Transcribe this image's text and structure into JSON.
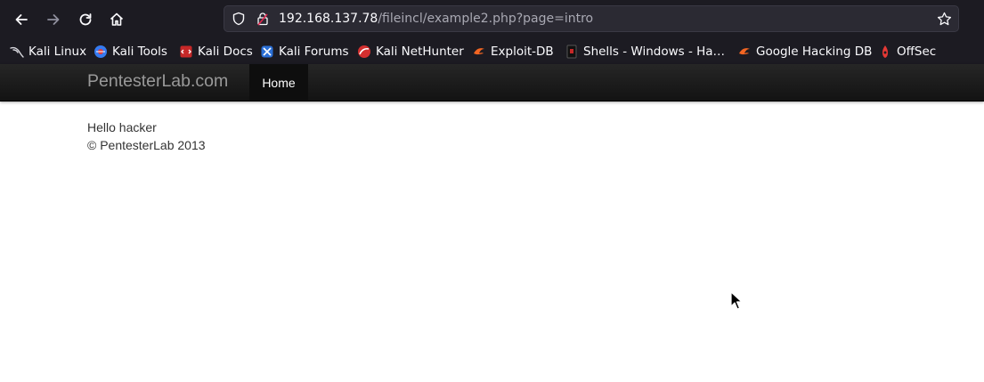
{
  "browser": {
    "url_host": "192.168.137.78",
    "url_path": "/fileincl/example2.php?page=intro",
    "icons": [
      "back-arrow-icon",
      "forward-arrow-icon",
      "reload-icon",
      "home-icon",
      "shield-icon",
      "lock-warning-icon",
      "star-icon"
    ]
  },
  "bookmarks": [
    {
      "label": "Kali Linux",
      "icon": "kali-dragon-icon"
    },
    {
      "label": "Kali Tools",
      "icon": "kali-tools-icon"
    },
    {
      "label": "Kali Docs",
      "icon": "kali-docs-icon"
    },
    {
      "label": "Kali Forums",
      "icon": "kali-forums-icon"
    },
    {
      "label": "Kali NetHunter",
      "icon": "kali-nethunter-icon"
    },
    {
      "label": "Exploit-DB",
      "icon": "exploit-db-icon"
    },
    {
      "label": "Shells - Windows - Ha…",
      "icon": "shells-icon"
    },
    {
      "label": "Google Hacking DB",
      "icon": "ghdb-icon"
    },
    {
      "label": "OffSec",
      "icon": "offsec-icon"
    }
  ],
  "site": {
    "brand": "PentesterLab.com",
    "nav": {
      "home": "Home"
    },
    "content": {
      "greeting": "Hello hacker",
      "footer": "© PentesterLab 2013"
    }
  },
  "colors": {
    "toolbar_bg": "#1c1b22",
    "urlbar_bg": "#2b2a33",
    "navbar_bg": "#1b1b1b",
    "brand_text": "#999999",
    "body_text": "#333333"
  }
}
